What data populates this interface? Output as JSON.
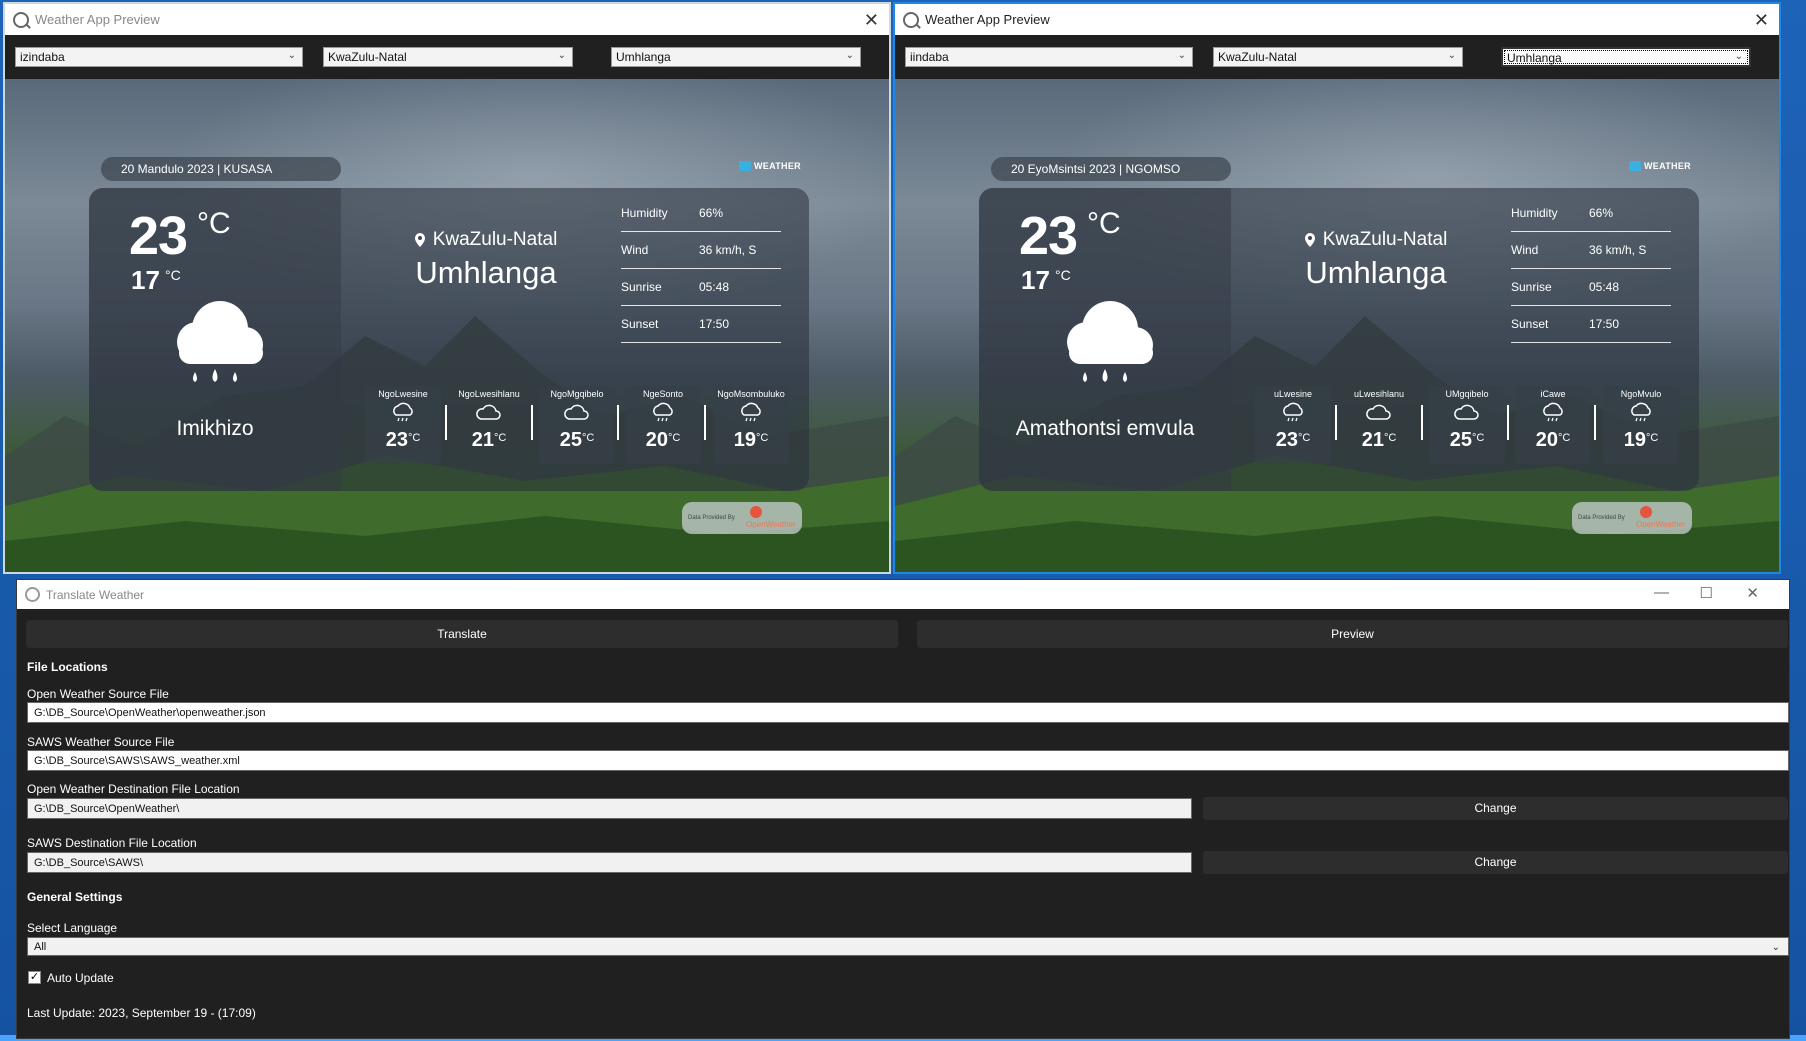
{
  "preview_left": {
    "title": "Weather App Preview",
    "close": "✕",
    "language": "izindaba",
    "province_select": "KwaZulu-Natal",
    "city_select": "Umhlanga",
    "date_text": "20 Mandulo 2023 | KUSASA",
    "brand": "WEATHER",
    "temp_high": "23",
    "temp_high_unit": "°C",
    "temp_low": "17",
    "temp_low_unit": "°C",
    "condition": "Imikhizo",
    "province": "KwaZulu-Natal",
    "city": "Umhlanga",
    "stats": [
      {
        "k": "Humidity",
        "v": "66%"
      },
      {
        "k": "Wind",
        "v": "36 km/h, S"
      },
      {
        "k": "Sunrise",
        "v": "05:48"
      },
      {
        "k": "Sunset",
        "v": "17:50"
      }
    ],
    "forecast": [
      {
        "day": "NgoLwesine",
        "temp": "23",
        "unit": "°C"
      },
      {
        "day": "NgoLwesihlanu",
        "temp": "21",
        "unit": "°C"
      },
      {
        "day": "NgoMgqibelo",
        "temp": "25",
        "unit": "°C"
      },
      {
        "day": "NgeSonto",
        "temp": "20",
        "unit": "°C"
      },
      {
        "day": "NgoMsombuluko",
        "temp": "19",
        "unit": "°C"
      }
    ],
    "data_provided_by": "Data Provided By",
    "provider": "OpenWeather"
  },
  "preview_right": {
    "title": "Weather App Preview",
    "close": "✕",
    "language": "iindaba",
    "province_select": "KwaZulu-Natal",
    "city_select": "Umhlanga",
    "date_text": "20 EyoMsintsi 2023 | NGOMSO",
    "brand": "WEATHER",
    "temp_high": "23",
    "temp_high_unit": "°C",
    "temp_low": "17",
    "temp_low_unit": "°C",
    "condition": "Amathontsi emvula",
    "province": "KwaZulu-Natal",
    "city": "Umhlanga",
    "stats": [
      {
        "k": "Humidity",
        "v": "66%"
      },
      {
        "k": "Wind",
        "v": "36 km/h, S"
      },
      {
        "k": "Sunrise",
        "v": "05:48"
      },
      {
        "k": "Sunset",
        "v": "17:50"
      }
    ],
    "forecast": [
      {
        "day": "uLwesine",
        "temp": "23",
        "unit": "°C"
      },
      {
        "day": "uLwesihlanu",
        "temp": "21",
        "unit": "°C"
      },
      {
        "day": "UMgqibelo",
        "temp": "25",
        "unit": "°C"
      },
      {
        "day": "iCawe",
        "temp": "20",
        "unit": "°C"
      },
      {
        "day": "NgoMvulo",
        "temp": "19",
        "unit": "°C"
      }
    ],
    "data_provided_by": "Data Provided By",
    "provider": "OpenWeather"
  },
  "translate": {
    "title": "Translate Weather",
    "minimize": "—",
    "maximize": "☐",
    "close": "✕",
    "translate_btn": "Translate",
    "preview_btn": "Preview",
    "section_files": "File Locations",
    "ow_source_label": "Open Weather Source File",
    "ow_source_value": "G:\\DB_Source\\OpenWeather\\openweather.json",
    "saws_source_label": "SAWS Weather Source File",
    "saws_source_value": "G:\\DB_Source\\SAWS\\SAWS_weather.xml",
    "ow_dest_label": "Open Weather Destination File Location",
    "ow_dest_value": "G:\\DB_Source\\OpenWeather\\",
    "saws_dest_label": "SAWS Destination File Location",
    "saws_dest_value": "G:\\DB_Source\\SAWS\\",
    "change_btn": "Change",
    "section_general": "General Settings",
    "lang_label": "Select Language",
    "lang_value": "All",
    "auto_update": "Auto Update",
    "check_mark": "✓",
    "last_update": "Last Update: 2023, September 19 - (17:09)"
  },
  "colors": {
    "accent": "#1e88e5",
    "window_bg": "#202020",
    "button_bg": "#2d2d2d"
  }
}
